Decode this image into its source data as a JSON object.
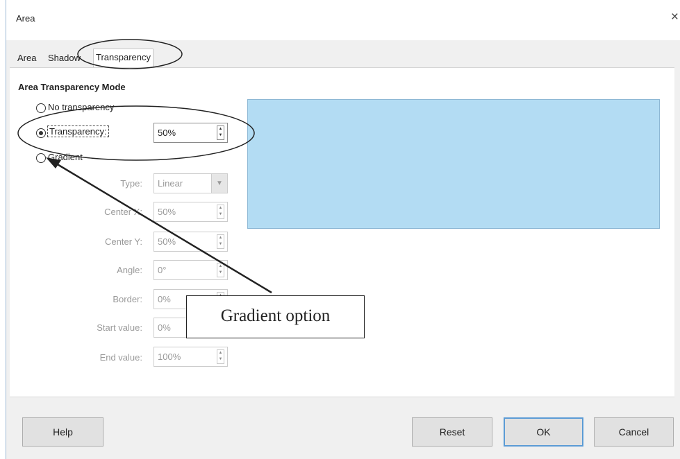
{
  "window": {
    "title": "Area",
    "close_symbol": "×"
  },
  "tabs": [
    {
      "label": "Area",
      "active": false
    },
    {
      "label": "Shadow",
      "active": false
    },
    {
      "label": "Transparency",
      "active": true
    }
  ],
  "section": {
    "title": "Area Transparency Mode"
  },
  "modes": {
    "none": {
      "label": "No transparency",
      "selected": false
    },
    "transparency": {
      "label": "Transparency:",
      "selected": true,
      "value": "50%"
    },
    "gradient": {
      "label": "Gradient",
      "selected": false
    }
  },
  "gradient_fields": {
    "type": {
      "label": "Type:",
      "value": "Linear"
    },
    "center_x": {
      "label": "Center X:",
      "value": "50%"
    },
    "center_y": {
      "label": "Center Y:",
      "value": "50%"
    },
    "angle": {
      "label": "Angle:",
      "value": "0°"
    },
    "border": {
      "label": "Border:",
      "value": "0%"
    },
    "start_value": {
      "label": "Start value:",
      "value": "0%"
    },
    "end_value": {
      "label": "End value:",
      "value": "100%"
    }
  },
  "preview": {
    "color": "#b3dcf3"
  },
  "buttons": {
    "help": "Help",
    "reset": "Reset",
    "ok": "OK",
    "cancel": "Cancel"
  },
  "annotation": {
    "callout_text": "Gradient option"
  }
}
